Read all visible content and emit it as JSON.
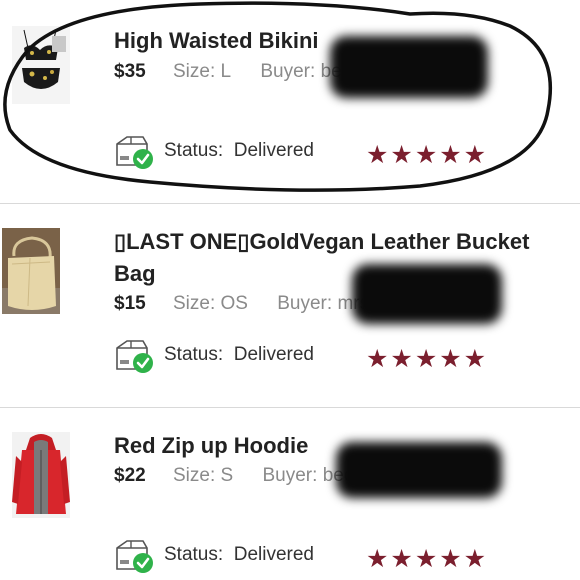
{
  "items": [
    {
      "title": "High Waisted Bikini",
      "price": "$35",
      "size_label": "Size:",
      "size_value": "L",
      "buyer_label": "Buyer:",
      "buyer_value": "beccalynne3",
      "status_label": "Status:",
      "status_value": "Delivered",
      "rating": 5,
      "stars": "★★★★★",
      "thumb_icon": "bikini-image"
    },
    {
      "title_line1": "▯LAST ONE▯GoldVegan Leather Bucket",
      "title_line2": "Bag",
      "price": "$15",
      "size_label": "Size:",
      "size_value": "OS",
      "buyer_label": "Buyer:",
      "buyer_value": "mrs_posh",
      "status_label": "Status:",
      "status_value": "Delivered",
      "rating": 5,
      "stars": "★★★★★",
      "thumb_icon": "bucket-bag-image"
    },
    {
      "title": "Red Zip up Hoodie",
      "price": "$22",
      "size_label": "Size:",
      "size_value": "S",
      "buyer_label": "Buyer:",
      "buyer_value": "beckyshane",
      "status_label": "Status:",
      "status_value": "Delivered",
      "rating": 5,
      "stars": "★★★★★",
      "thumb_icon": "red-hoodie-image"
    }
  ],
  "colors": {
    "star": "#7b1f2e",
    "delivered_check": "#2fb24a",
    "muted_text": "#8a8a8a",
    "annotation": "#111111"
  }
}
